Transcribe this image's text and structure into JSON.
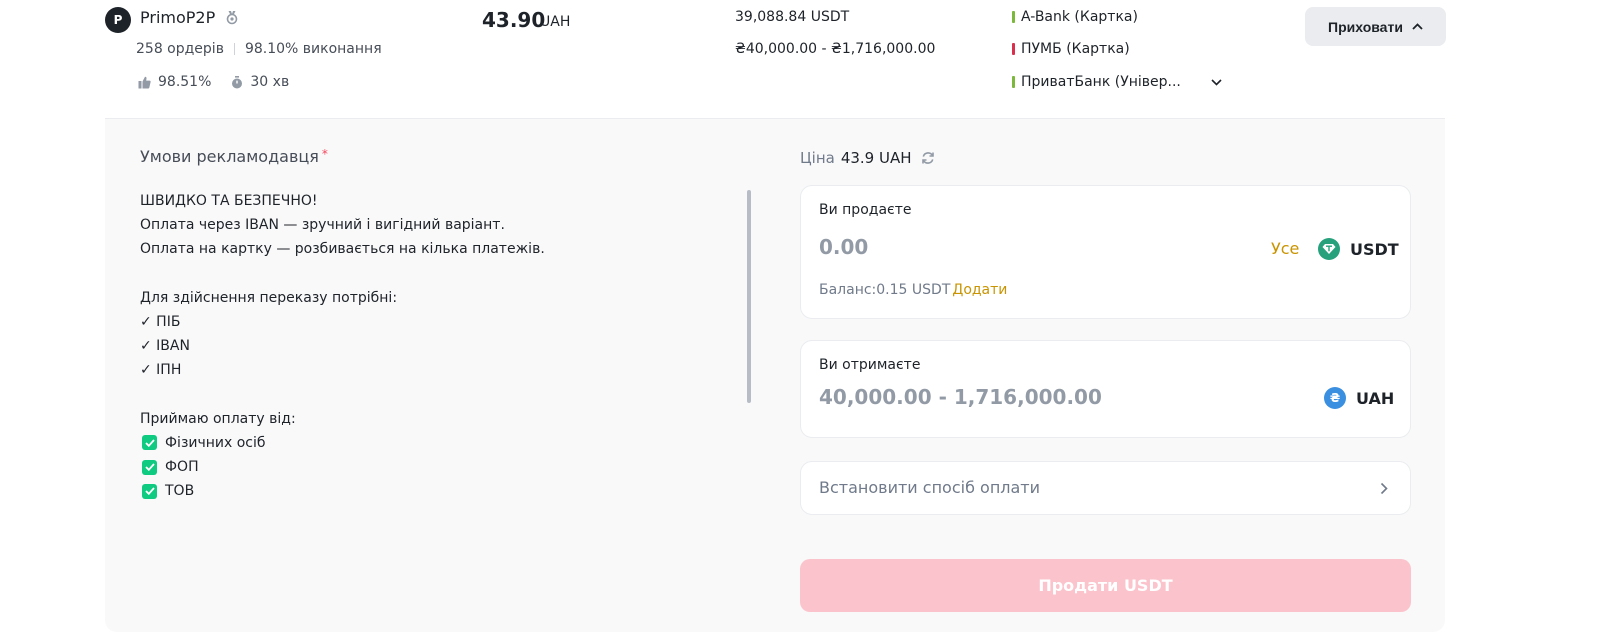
{
  "merchant": {
    "avatar_letter": "P",
    "name": "PrimoP2P",
    "orders": "258 ордерів",
    "completion": "98.10% виконання",
    "positive_rate": "98.51%",
    "pay_time": "30 хв"
  },
  "offer": {
    "price": "43.90",
    "price_currency": "UAH",
    "available": "39,088.84 USDT",
    "limits": "₴40,000.00 - ₴1,716,000.00",
    "payment_methods": [
      {
        "label": "A-Bank (Картка)",
        "color": "#7bb83b"
      },
      {
        "label": "ПУМБ (Картка)",
        "color": "#d9304c"
      },
      {
        "label": "ПриватБанк (Універ...",
        "color": "#7bb83b"
      }
    ],
    "hide_label": "Приховати"
  },
  "terms": {
    "title": "Умови рекламодавця",
    "required_mark": "*",
    "lines": [
      {
        "type": "text",
        "text": "ШВИДКО ТА БЕЗПЕЧНО!"
      },
      {
        "type": "text",
        "text": "Оплата через IBAN — зручний і вигідний варіант."
      },
      {
        "type": "text",
        "text": "Оплата на картку — розбивається на кілька платежів."
      },
      {
        "type": "blank",
        "text": ""
      },
      {
        "type": "text",
        "text": "Для здійснення переказу потрібні:"
      },
      {
        "type": "text",
        "text": "✓ ПІБ"
      },
      {
        "type": "text",
        "text": "✓ IBAN"
      },
      {
        "type": "text",
        "text": "✓ ІПН"
      },
      {
        "type": "blank",
        "text": ""
      },
      {
        "type": "text",
        "text": "Приймаю оплату від:"
      },
      {
        "type": "check",
        "text": "Фізичних осіб"
      },
      {
        "type": "check",
        "text": "ФОП"
      },
      {
        "type": "check",
        "text": "ТОВ"
      }
    ]
  },
  "form": {
    "price_label": "Ціна",
    "price_value": "43.9 UAH",
    "sell": {
      "label": "Ви продаєте",
      "placeholder": "0.00",
      "all_label": "Усе",
      "currency": "USDT",
      "balance_label": "Баланс:0.15 USDT",
      "add_label": "Додати"
    },
    "receive": {
      "label": "Ви отримаєте",
      "placeholder": "40,000.00 - 1,716,000.00",
      "currency": "UAH"
    },
    "method_label": "Встановити спосіб оплати",
    "submit_label": "Продати USDT"
  },
  "colors": {
    "accent_gold": "#c99400",
    "usdt_green": "#26a17b",
    "uah_blue": "#3b8fe0",
    "check_green": "#0ecb81",
    "sell_disabled": "#fbc4cc"
  }
}
